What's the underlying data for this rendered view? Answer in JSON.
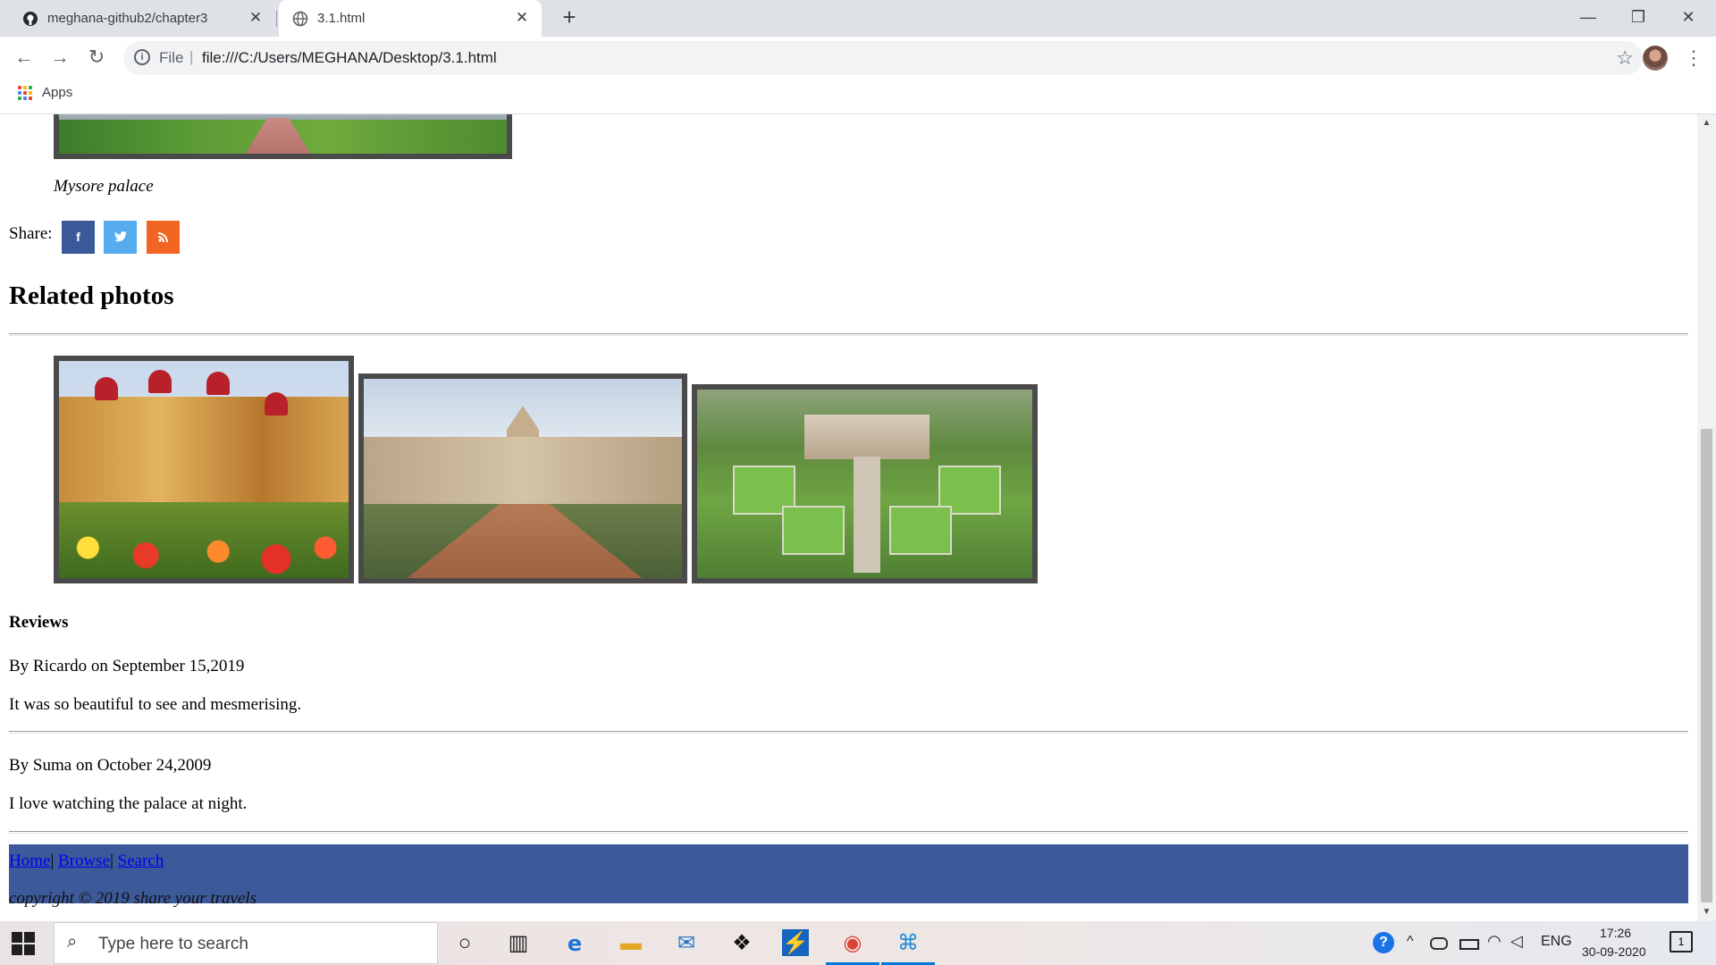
{
  "browser": {
    "tabs": [
      {
        "title": "meghana-github2/chapter3",
        "icon": "github-icon",
        "active": false
      },
      {
        "title": "3.1.html",
        "icon": "globe-icon",
        "active": true
      }
    ],
    "close_glyph": "✕",
    "new_tab_glyph": "+",
    "window_controls": {
      "minimize": "—",
      "restore": "❐",
      "close": "✕"
    },
    "nav": {
      "back": "←",
      "forward": "→",
      "reload": "↻"
    },
    "omnibox": {
      "info_glyph": "i",
      "scheme_label": "File",
      "separator": "|",
      "url": "file:///C:/Users/MEGHANA/Desktop/3.1.html",
      "star_glyph": "☆"
    },
    "menu_glyph": "⋮",
    "bookmarks": {
      "apps_label": "Apps",
      "apps_colors": [
        "#ea4335",
        "#fbbc05",
        "#34a853",
        "#4285f4",
        "#ea4335",
        "#fbbc05",
        "#34a853",
        "#4285f4",
        "#ea4335"
      ]
    }
  },
  "page": {
    "main_caption": "Mysore palace",
    "share": {
      "label": "Share:",
      "buttons": [
        {
          "name": "facebook",
          "glyph": "f",
          "color": "#3b5998"
        },
        {
          "name": "twitter",
          "glyph": "t",
          "color": "#55acee"
        },
        {
          "name": "rss",
          "glyph": "≋",
          "color": "#f26522"
        }
      ]
    },
    "related_heading": "Related photos",
    "reviews_heading": "Reviews",
    "reviews": [
      {
        "author_line": "By Ricardo on September 15,2019",
        "text": "It was so beautiful to see and mesmerising."
      },
      {
        "author_line": "By Suma on October 24,2009",
        "text": "I love watching the palace at night."
      }
    ],
    "footer": {
      "links": [
        "Home",
        "Browse",
        "Search"
      ],
      "separator": "|",
      "copyright": "copyright © 2019 share your travels",
      "background": "#3c5a99"
    }
  },
  "scrollbar": {
    "up_glyph": "▲",
    "down_glyph": "▼"
  },
  "taskbar": {
    "search_placeholder": "Type here to search",
    "search_glyph": "⌕",
    "apps": [
      {
        "name": "cortana",
        "glyph": "○"
      },
      {
        "name": "task-view",
        "glyph": "▥"
      },
      {
        "name": "edge",
        "glyph": "e"
      },
      {
        "name": "file-explorer",
        "glyph": "▬"
      },
      {
        "name": "mail",
        "glyph": "✉"
      },
      {
        "name": "dropbox",
        "glyph": "❖"
      },
      {
        "name": "power-automate",
        "glyph": "⚡"
      },
      {
        "name": "chrome",
        "glyph": "◉"
      },
      {
        "name": "vscode",
        "glyph": "⌘"
      }
    ],
    "tray": {
      "help": "?",
      "chevron": "^",
      "language": "ENG"
    },
    "clock": {
      "time": "17:26",
      "date": "30-09-2020"
    },
    "notification_count": "1"
  }
}
